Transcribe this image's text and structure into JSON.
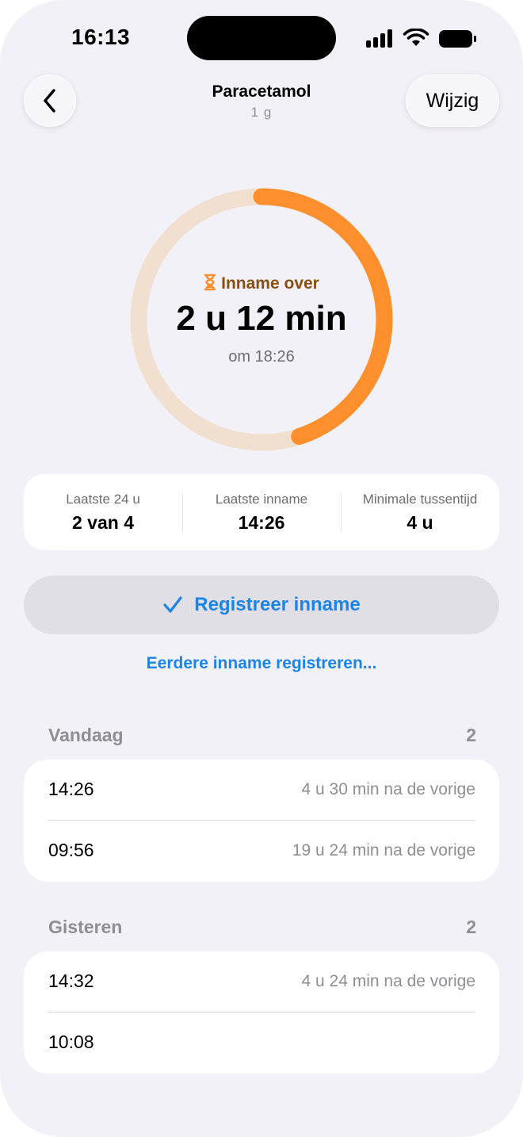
{
  "status_bar": {
    "time": "16:13"
  },
  "nav": {
    "title": "Paracetamol",
    "subtitle": "1 g",
    "edit_label": "Wijzig"
  },
  "timer": {
    "label": "Inname over",
    "remaining": "2 u 12 min",
    "at": "om 18:26",
    "progress_fraction": 0.45,
    "accent_color": "#fd8f2c",
    "track_color": "#f1dfd0"
  },
  "stats": [
    {
      "label": "Laatste 24 u",
      "value": "2 van 4"
    },
    {
      "label": "Laatste inname",
      "value": "14:26"
    },
    {
      "label": "Minimale tussentijd",
      "value": "4 u"
    }
  ],
  "actions": {
    "register_label": "Registreer inname",
    "earlier_label": "Eerdere inname registreren..."
  },
  "sections": [
    {
      "title": "Vandaag",
      "count": "2",
      "items": [
        {
          "time": "14:26",
          "gap": "4 u 30 min na de vorige"
        },
        {
          "time": "09:56",
          "gap": "19 u 24 min na de vorige"
        }
      ]
    },
    {
      "title": "Gisteren",
      "count": "2",
      "items": [
        {
          "time": "14:32",
          "gap": "4 u 24 min na de vorige"
        },
        {
          "time": "10:08",
          "gap": ""
        }
      ]
    }
  ],
  "colors": {
    "accent_blue": "#1a84e8",
    "background": "#f2f1f7"
  }
}
